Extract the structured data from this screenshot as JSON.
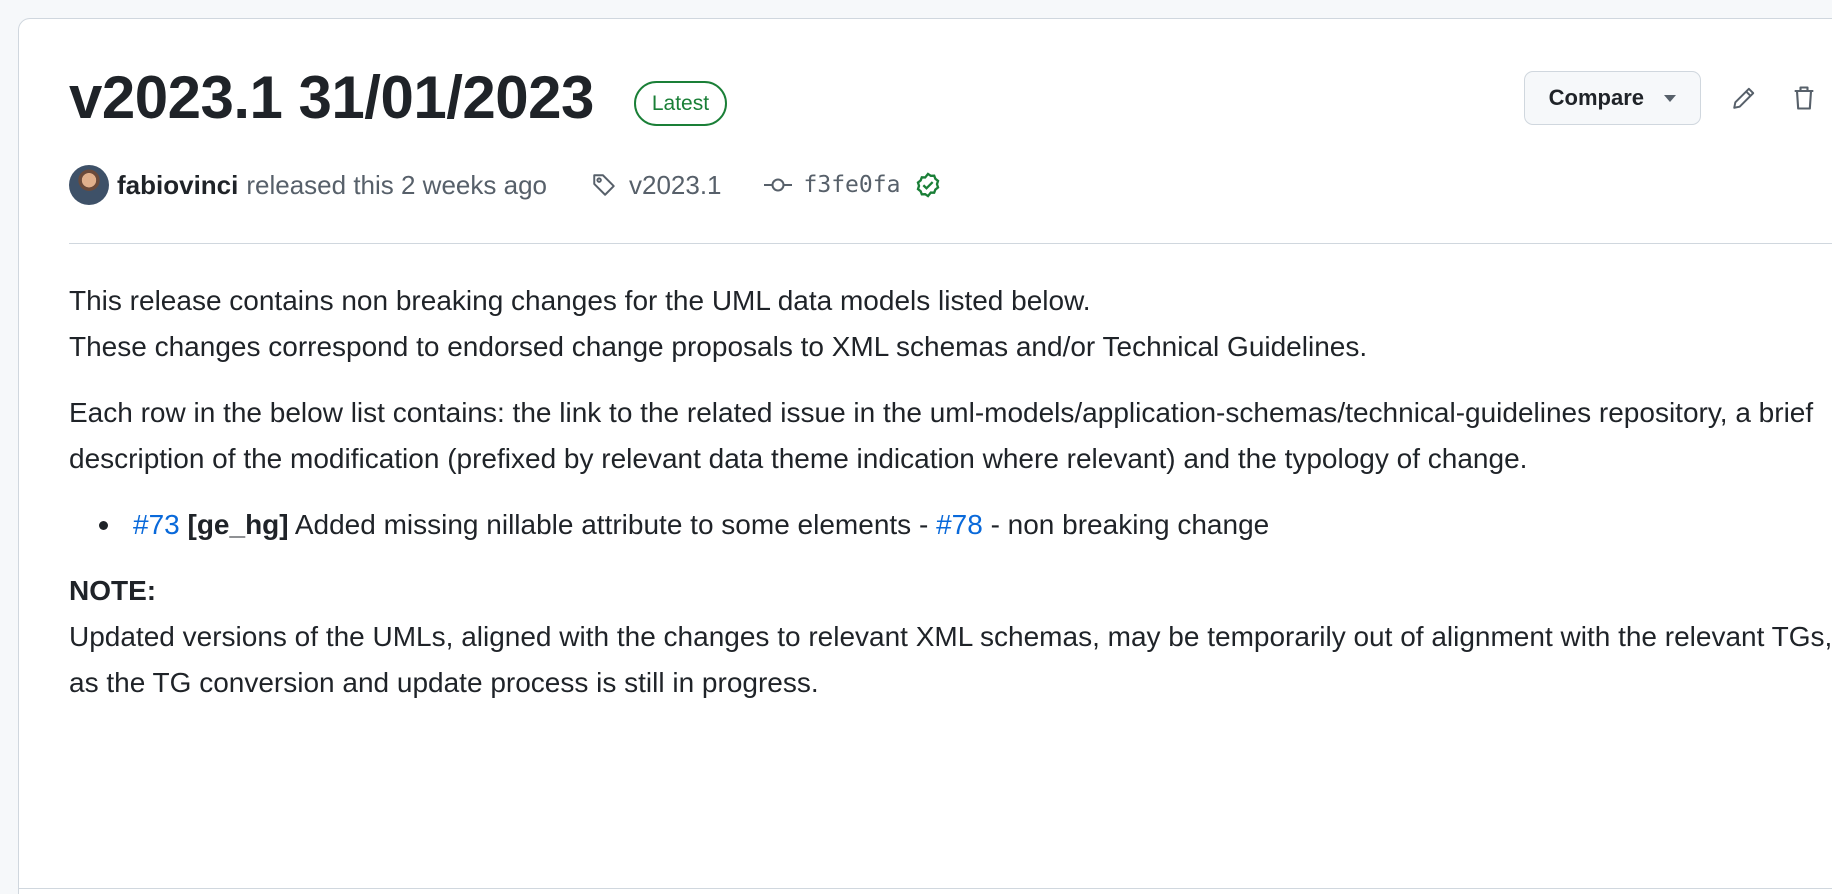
{
  "release": {
    "title": "v2023.1 31/01/2023",
    "badge": "Latest"
  },
  "actions": {
    "compare_label": "Compare",
    "edit_icon": "pencil-icon",
    "delete_icon": "trash-icon"
  },
  "meta": {
    "author": "fabiovinci",
    "released_text": "released this 2 weeks ago",
    "tag": "v2023.1",
    "commit": "f3fe0fa",
    "verified_icon": "check-circle-icon"
  },
  "body": {
    "intro_line1": "This release contains non breaking changes for the UML data models listed below.",
    "intro_line2": "These changes correspond to endorsed change proposals to XML schemas and/or Technical Guidelines.",
    "paragraph2": "Each row in the below list contains: the link to the related issue in the uml-models/application-schemas/technical-guidelines repository, a brief description of the modification (prefixed by relevant data theme indication where relevant) and the typology of change.",
    "list": [
      {
        "issue_link": "#73",
        "theme": "[ge_hg]",
        "description": "Added missing nillable attribute to some elements -",
        "pr_link": "#78",
        "change_type": "- non breaking change"
      }
    ],
    "note_title": "NOTE:",
    "note_text": "Updated versions of the UMLs, aligned with the changes to relevant XML schemas, may be temporarily out of alignment with the relevant TGs, as the TG conversion and update process is still in progress."
  },
  "colors": {
    "link": "#0969da",
    "latest_green": "#1a7f37",
    "muted": "#57606a",
    "border": "#d0d7de"
  }
}
